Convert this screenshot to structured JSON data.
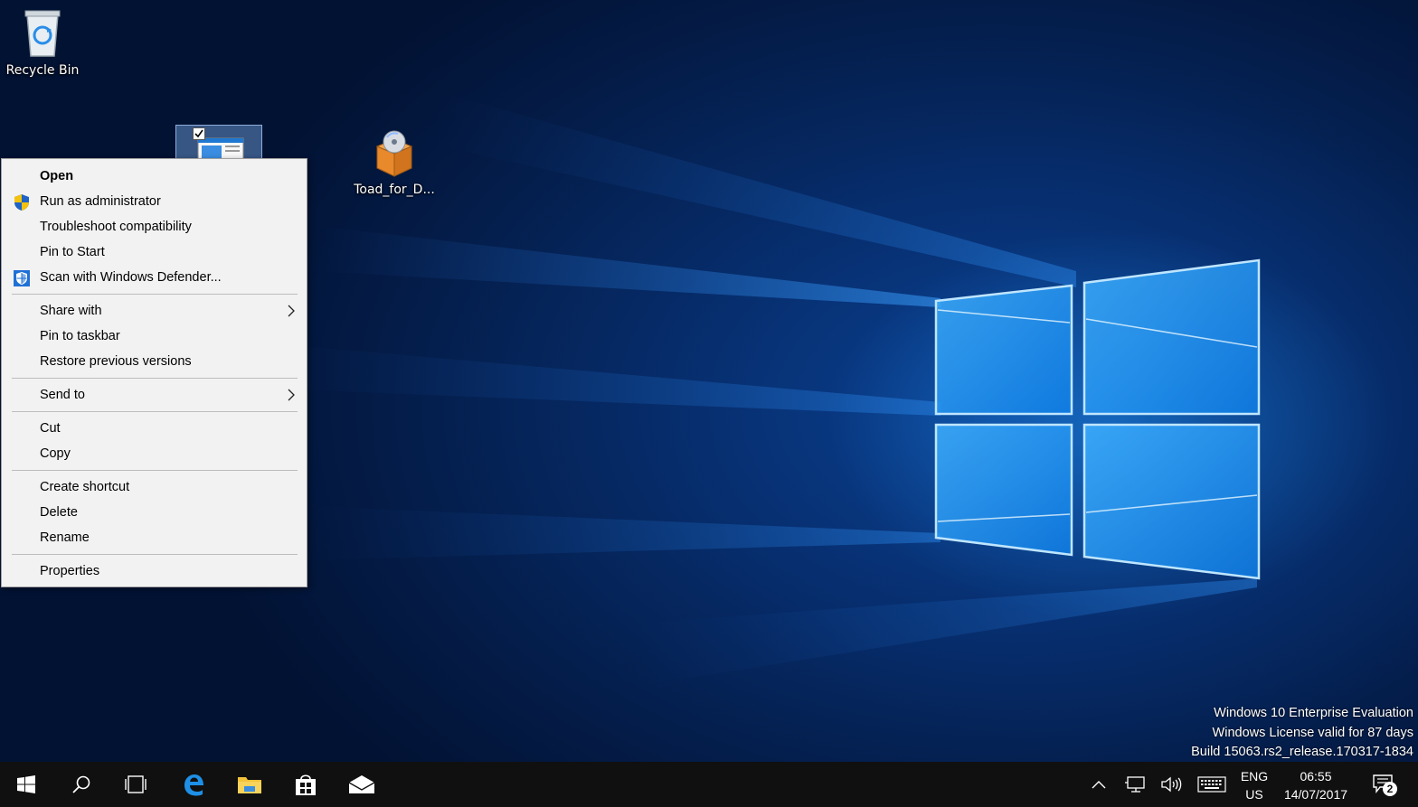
{
  "desktop": {
    "icons": [
      {
        "label": "Recycle Bin",
        "icon": "recycle-bin-icon"
      },
      {
        "label": "",
        "icon": "application-window-icon",
        "selected": true
      },
      {
        "label": "Toad_for_D...",
        "icon": "installer-package-icon"
      }
    ]
  },
  "context_menu": {
    "groups": [
      [
        {
          "label": "Open",
          "bold": true
        },
        {
          "label": "Run as administrator",
          "icon": "uac-shield-icon"
        },
        {
          "label": "Troubleshoot compatibility"
        },
        {
          "label": "Pin to Start"
        },
        {
          "label": "Scan with Windows Defender...",
          "icon": "windows-defender-icon"
        }
      ],
      [
        {
          "label": "Share with",
          "submenu": true
        },
        {
          "label": "Pin to taskbar"
        },
        {
          "label": "Restore previous versions"
        }
      ],
      [
        {
          "label": "Send to",
          "submenu": true
        }
      ],
      [
        {
          "label": "Cut"
        },
        {
          "label": "Copy"
        }
      ],
      [
        {
          "label": "Create shortcut"
        },
        {
          "label": "Delete"
        },
        {
          "label": "Rename"
        }
      ],
      [
        {
          "label": "Properties"
        }
      ]
    ]
  },
  "watermark": {
    "line1": "Windows 10 Enterprise Evaluation",
    "line2": "Windows License valid for 87 days",
    "line3": "Build 15063.rs2_release.170317-1834"
  },
  "taskbar": {
    "pinned": [
      "start-icon",
      "search-icon",
      "task-view-icon",
      "edge-icon",
      "file-explorer-icon",
      "store-icon",
      "mail-icon"
    ],
    "tray": {
      "language_top": "ENG",
      "language_bottom": "US",
      "time": "06:55",
      "date": "14/07/2017",
      "notification_count": "2"
    }
  },
  "colors": {
    "menu_bg": "#f2f2f2",
    "taskbar_bg": "#101010",
    "accent": "#0078d7"
  }
}
